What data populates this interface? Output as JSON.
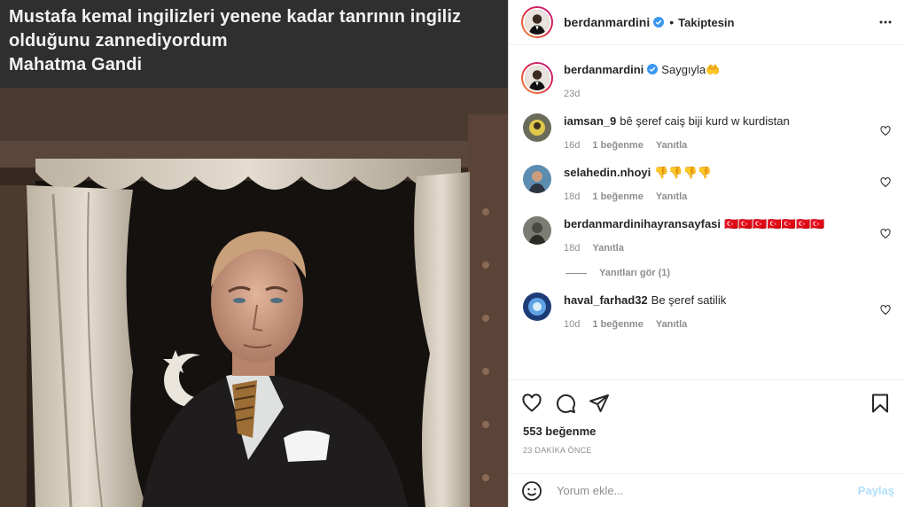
{
  "post": {
    "caption_lines": [
      "Mustafa kemal ingilizleri yenene kadar tanrının  ingiliz",
      "olduğunu zannediyordum",
      "Mahatma Gandi"
    ]
  },
  "header": {
    "username": "berdanmardini",
    "dot": "•",
    "follow_label": "Takiptesin"
  },
  "main_caption": {
    "username": "berdanmardini",
    "text": "Saygıyla🤲",
    "time": "23d"
  },
  "comments": [
    {
      "username": "iamsan_9",
      "text": "bê şeref caiş biji kurd w kurdistan",
      "time": "16d",
      "likes": "1 beğenme",
      "reply": "Yanıtla"
    },
    {
      "username": "selahedin.nhoyi",
      "text": "👎👎👎👎",
      "time": "18d",
      "likes": "1 beğenme",
      "reply": "Yanıtla"
    },
    {
      "username": "berdanmardinihayransayfasi",
      "text": "🇹🇷🇹🇷🇹🇷🇹🇷🇹🇷🇹🇷🇹🇷",
      "time": "18d",
      "reply": "Yanıtla",
      "view_replies": "Yanıtları gör (1)"
    },
    {
      "username": "haval_farhad32",
      "text": "Be şeref satilik",
      "time": "10d",
      "likes": "1 beğenme",
      "reply": "Yanıtla"
    }
  ],
  "actions": {
    "likes_text": "553 beğenme",
    "timestamp": "23 DAKİKA ÖNCE"
  },
  "comment_box": {
    "placeholder": "Yorum ekle...",
    "post_label": "Paylaş"
  },
  "colors": {
    "verified": "#3897f0",
    "banner_bg": "#2f2f2f",
    "post_btn_disabled": "#b2dffc"
  }
}
